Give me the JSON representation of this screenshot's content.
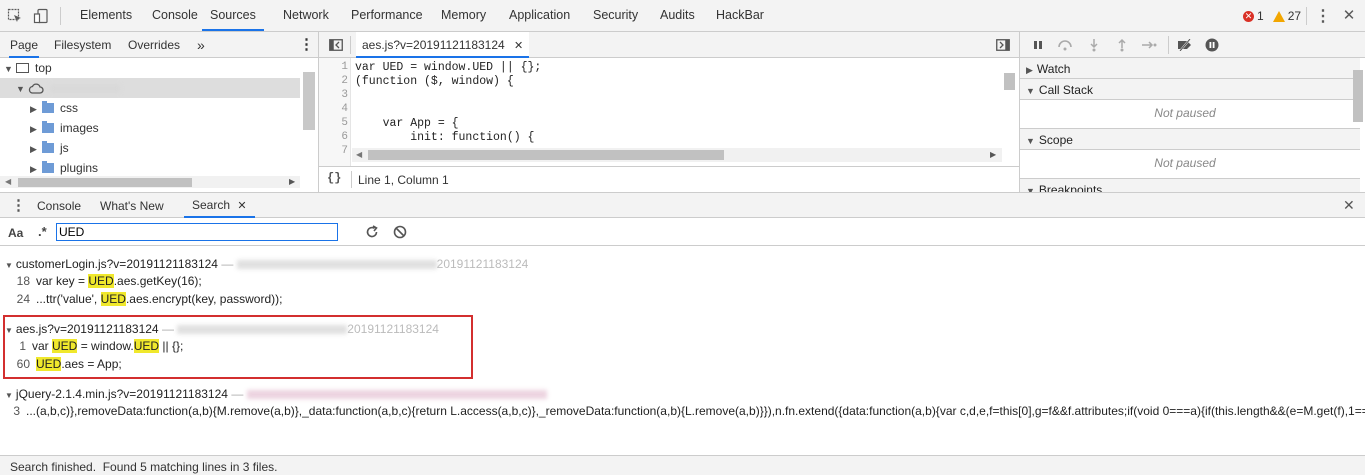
{
  "toolbar": {
    "tabs": [
      "Elements",
      "Console",
      "Sources",
      "Network",
      "Performance",
      "Memory",
      "Application",
      "Security",
      "Audits",
      "HackBar"
    ],
    "active_tab": "Sources",
    "errors": "1",
    "warnings": "27"
  },
  "navigator": {
    "tabs": [
      "Page",
      "Filesystem",
      "Overrides"
    ],
    "more": "»",
    "tree": {
      "top": "top",
      "folders": [
        "css",
        "images",
        "js",
        "plugins"
      ]
    }
  },
  "editor": {
    "file_tab": "aes.js?v=20191121183124",
    "lines": [
      {
        "n": "1",
        "text": "var UED = window.UED || {};"
      },
      {
        "n": "2",
        "text": "(function ($, window) {"
      },
      {
        "n": "3",
        "text": ""
      },
      {
        "n": "4",
        "text": ""
      },
      {
        "n": "5",
        "text": "    var App = {"
      },
      {
        "n": "6",
        "text": "        init: function() {"
      },
      {
        "n": "7",
        "text": ""
      }
    ],
    "status": "Line 1, Column 1",
    "pretty_print": "{}"
  },
  "debugger": {
    "sections": [
      "Watch",
      "Call Stack",
      "Scope",
      "Breakpoints"
    ],
    "not_paused": "Not paused"
  },
  "drawer": {
    "tabs": [
      "Console",
      "What's New",
      "Search"
    ],
    "active_tab": "Search",
    "case_toggle": "Aa",
    "regex_toggle": ".*",
    "query": "UED"
  },
  "results": [
    {
      "file": "customerLogin.js?v=20191121183124",
      "path_suffix": "20191121183124",
      "lines": [
        {
          "n": "18",
          "pre": "var key = ",
          "hit": "UED",
          "post": ".aes.getKey(16);"
        },
        {
          "n": "24",
          "pre": "...ttr('value', ",
          "hit": "UED",
          "post": ".aes.encrypt(key, password));"
        }
      ]
    },
    {
      "file": "aes.js?v=20191121183124",
      "path_suffix": "20191121183124",
      "lines": [
        {
          "n": "1",
          "pre": "var ",
          "hit": "UED",
          "mid": " = window.",
          "hit2": "UED",
          "post": " || {};"
        },
        {
          "n": "60",
          "pre": "",
          "hit": "UED",
          "post": ".aes = App;"
        }
      ]
    },
    {
      "file": "jQuery-2.1.4.min.js?v=20191121183124",
      "lines": [
        {
          "n": "3",
          "text": "...(a,b,c)},removeData:function(a,b){M.remove(a,b)},_data:function(a,b,c){return L.access(a,b,c)},_removeData:function(a,b){L.remove(a,b)}}),n.fn.extend({data:function(a,b){var c,d,e,f=this[0],g=f&&f.attributes;if(void 0===a){if(this.length&&(e=M.get(f),1=="
        }
      ]
    }
  ],
  "status_bar": "Search finished.  Found 5 matching lines in 3 files.",
  "colors": {
    "highlight": "#f0e82c",
    "accent": "#1a73e8",
    "error": "#d93025",
    "warning": "#f2a600",
    "result_border": "#d32f2f"
  }
}
